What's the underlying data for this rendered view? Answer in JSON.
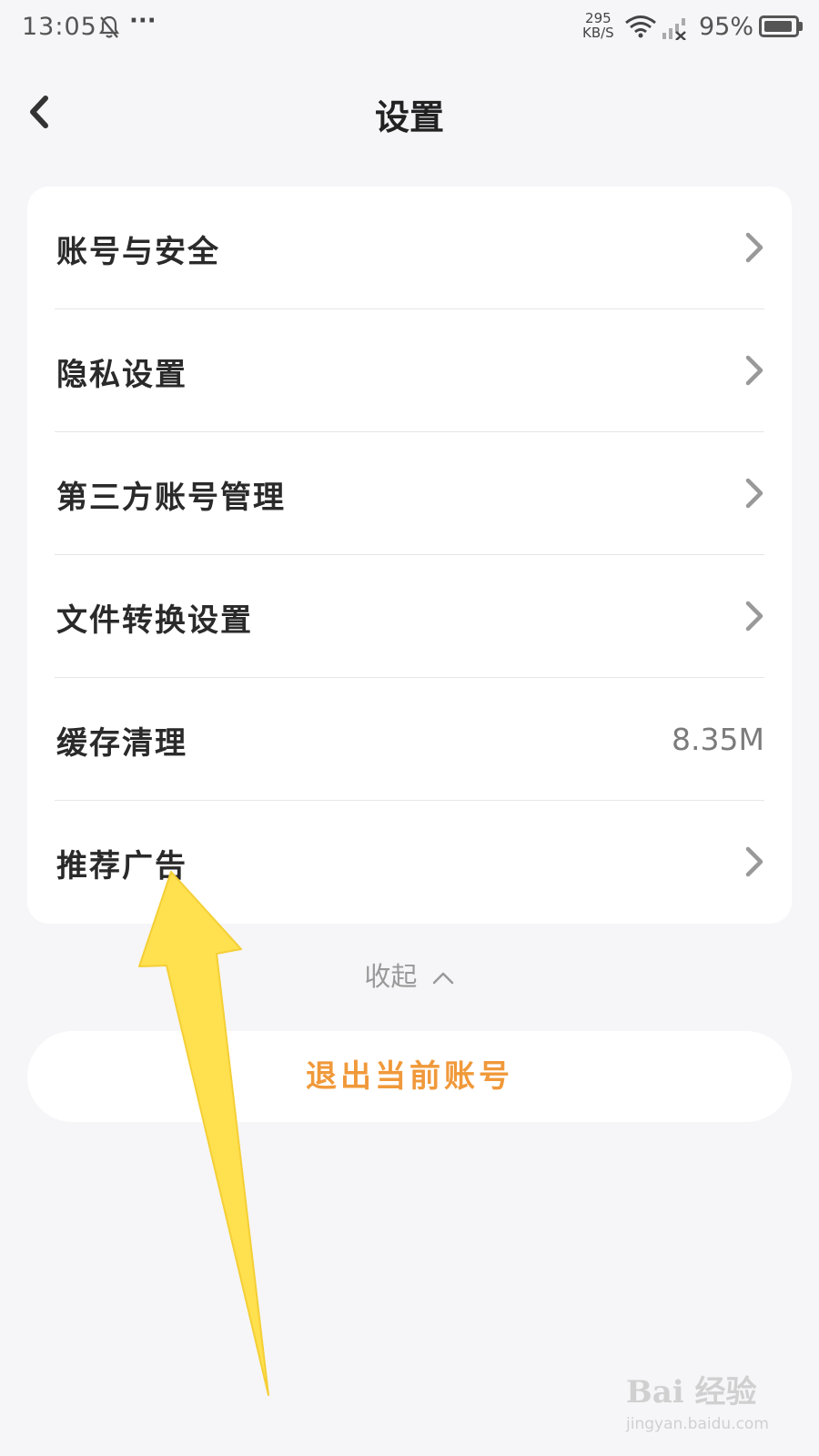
{
  "status_bar": {
    "time": "13:05",
    "more": "···",
    "speed_value": "295",
    "speed_unit": "KB/S",
    "battery_percent": "95%",
    "battery_level": 0.95,
    "icons": [
      "bell-off-icon",
      "wifi-icon",
      "signal-off-icon",
      "battery-icon"
    ]
  },
  "header": {
    "title": "设置",
    "back_icon": "chevron-left-icon"
  },
  "settings": {
    "items": [
      {
        "label": "账号与安全",
        "chevron": true
      },
      {
        "label": "隐私设置",
        "chevron": true
      },
      {
        "label": "第三方账号管理",
        "chevron": true
      },
      {
        "label": "文件转换设置",
        "chevron": true
      },
      {
        "label": "缓存清理",
        "value": "8.35M",
        "chevron": false
      },
      {
        "label": "推荐广告",
        "chevron": true
      }
    ]
  },
  "collapse": {
    "label": "收起",
    "icon": "chevron-up-icon"
  },
  "logout": {
    "label": "退出当前账号",
    "color": "#f0993a"
  },
  "annotation": {
    "arrow_color": "#ffe04e",
    "points_to": "推荐广告"
  },
  "watermark": {
    "main": "Bai 经验",
    "sub": "jingyan.baidu.com"
  },
  "colors": {
    "background": "#f6f6f8",
    "card": "#ffffff",
    "accent": "#f0993a"
  }
}
